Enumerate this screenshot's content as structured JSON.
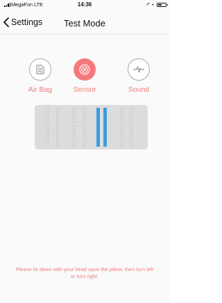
{
  "status_bar": {
    "carrier": "MegaFon  LTE",
    "time": "14:36",
    "location_icon": "location-arrow-icon",
    "bluetooth_icon": "bluetooth-icon",
    "battery_icon": "battery-icon",
    "battery_level": 0.35
  },
  "nav": {
    "back_label": "Settings",
    "back_icon": "chevron-left-icon",
    "title": "Test Mode"
  },
  "modes": [
    {
      "label": "Air Bag",
      "icon": "air-bag-icon",
      "selected": false
    },
    {
      "label": "Sensor",
      "icon": "sensor-icon",
      "selected": true
    },
    {
      "label": "Sound",
      "icon": "sound-wave-icon",
      "selected": false
    }
  ],
  "sensor_panel": {
    "strips": [
      {
        "active": false
      },
      {
        "active": false
      },
      {
        "active": false
      },
      {
        "active": false
      },
      {
        "active": true
      },
      {
        "active": true
      },
      {
        "active": false
      },
      {
        "active": false
      }
    ]
  },
  "hint": "Please lie down with your head upon the pillow, then turn left or turn right.",
  "colors": {
    "accent": "#f5797c",
    "label": "#f07a79",
    "sensor_active": "#3d9cde",
    "panel": "#dcdcdc"
  }
}
